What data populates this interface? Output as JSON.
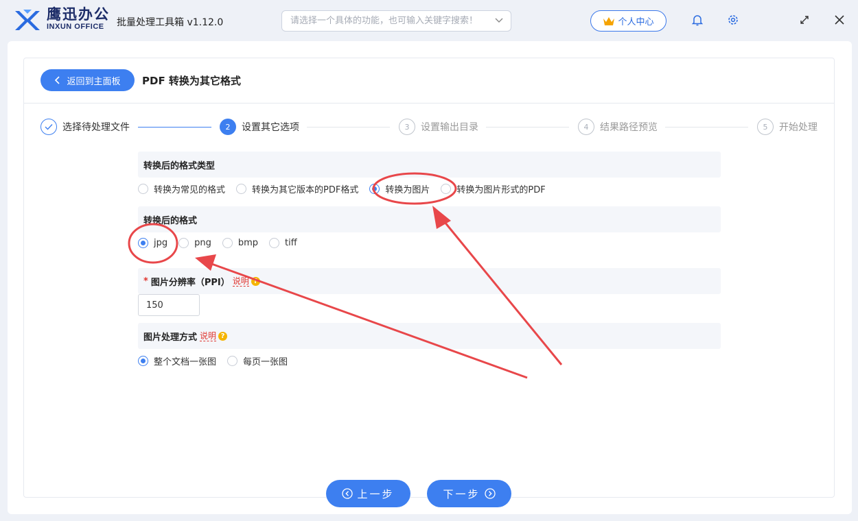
{
  "app": {
    "brand_cn": "鹰迅办公",
    "brand_en": "INXUN OFFICE",
    "title": "批量处理工具箱 v1.12.0",
    "search_placeholder": "请选择一个具体的功能，也可输入关键字搜索！",
    "user_center": "个人中心",
    "icons": [
      "bell-icon",
      "gear-icon",
      "maximize-icon",
      "close-icon"
    ]
  },
  "page": {
    "back_label": "返回到主面板",
    "title": "PDF 转换为其它格式"
  },
  "steps": [
    {
      "num": "",
      "label": "选择待处理文件",
      "status": "done"
    },
    {
      "num": "2",
      "label": "设置其它选项",
      "status": "active"
    },
    {
      "num": "3",
      "label": "设置输出目录",
      "status": "todo"
    },
    {
      "num": "4",
      "label": "结果路径预览",
      "status": "todo"
    },
    {
      "num": "5",
      "label": "开始处理",
      "status": "todo"
    }
  ],
  "format_type": {
    "heading": "转换后的格式类型",
    "options": [
      "转换为常见的格式",
      "转换为其它版本的PDF格式",
      "转换为图片",
      "转换为图片形式的PDF"
    ],
    "selected": "转换为图片"
  },
  "format": {
    "heading": "转换后的格式",
    "options": [
      "jpg",
      "png",
      "bmp",
      "tiff"
    ],
    "selected": "jpg"
  },
  "resolution": {
    "required_mark": "*",
    "heading": "图片分辨率（PPI）",
    "explain": "说明",
    "value": "150"
  },
  "image_mode": {
    "heading": "图片处理方式",
    "explain": "说明",
    "options": [
      "整个文档一张图",
      "每页一张图"
    ],
    "selected": "整个文档一张图"
  },
  "footer": {
    "prev_label": "上一步",
    "next_label": "下一步"
  },
  "colors": {
    "accent": "#3d7ff0",
    "annotation": "#e8474a"
  }
}
